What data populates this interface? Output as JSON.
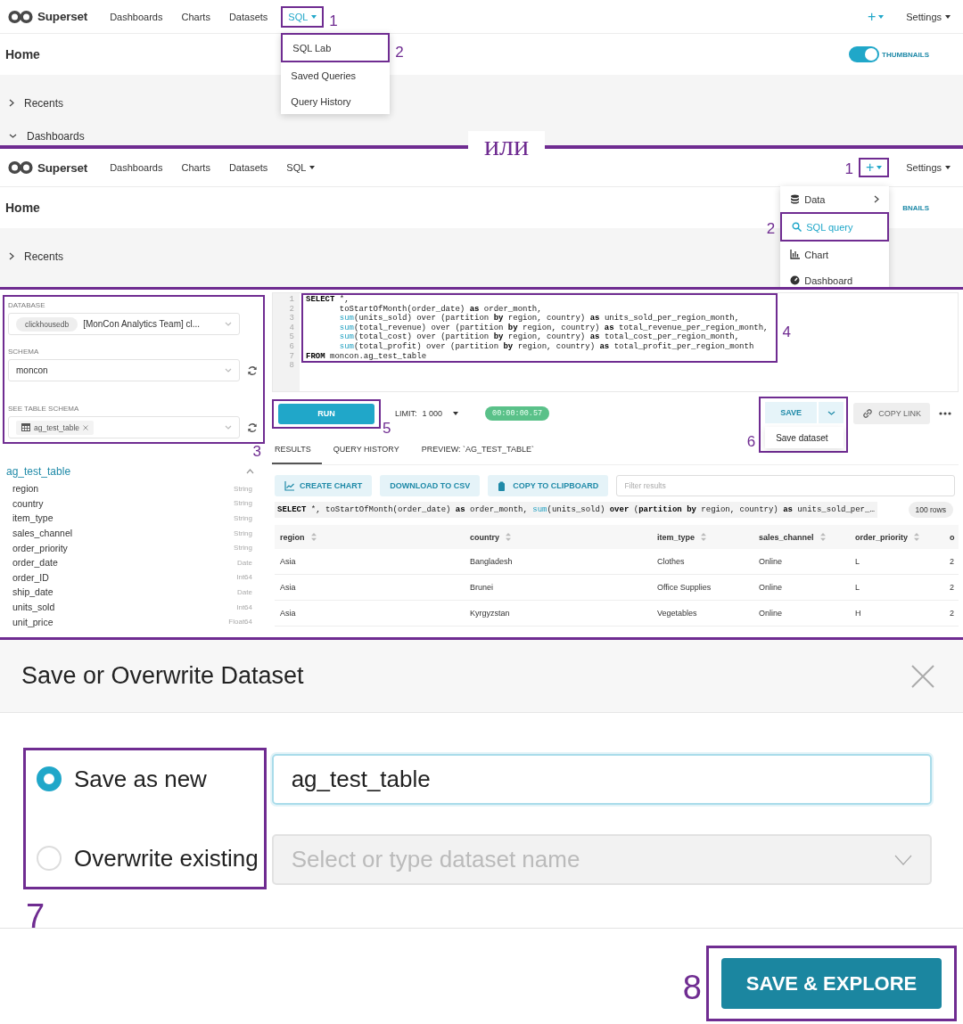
{
  "navigation_screens": [
    {
      "brand": "Superset",
      "nav_items": [
        {
          "label": "Dashboards",
          "selected": false
        },
        {
          "label": "Charts",
          "selected": false
        },
        {
          "label": "Datasets",
          "selected": false
        },
        {
          "label": "SQL",
          "selected": true,
          "has_menu": true,
          "annotation": {
            "number": "1"
          },
          "dropdown": {
            "items": [
              {
                "label": "SQL Lab",
                "selected": false,
                "annotation": {
                  "number": "2"
                }
              },
              {
                "label": "Saved Queries",
                "selected": false
              },
              {
                "label": "Query History",
                "selected": false
              }
            ]
          }
        }
      ],
      "add_button": {
        "label": "+"
      },
      "settings": "Settings",
      "page_title": "Home",
      "thumbnails": {
        "label": "THUMBNAILS",
        "on": true
      },
      "sections": [
        {
          "label": "Recents",
          "expanded": false
        },
        {
          "label": "Dashboards",
          "expanded": true
        }
      ]
    },
    {
      "brand": "Superset",
      "nav_items": [
        {
          "label": "Dashboards",
          "selected": false
        },
        {
          "label": "Charts",
          "selected": false
        },
        {
          "label": "Datasets",
          "selected": false
        },
        {
          "label": "SQL",
          "selected": false,
          "has_menu": true
        }
      ],
      "add_button": {
        "label": "+",
        "annotation": {
          "number": "1"
        },
        "dropdown": {
          "items": [
            {
              "label": "Data",
              "selected": false,
              "has_submenu": true
            },
            {
              "label": "SQL query",
              "selected": true,
              "annotation": {
                "number": "2"
              }
            },
            {
              "label": "Chart",
              "selected": false
            },
            {
              "label": "Dashboard",
              "selected": false
            }
          ]
        }
      },
      "settings": "Settings",
      "page_title": "Home",
      "thumbnails": {
        "label": "BNAILS"
      },
      "sections": [
        {
          "label": "Recents",
          "expanded": false
        }
      ]
    }
  ],
  "separator": "или",
  "sql_lab": {
    "sidebar": {
      "annotation": {
        "number": "3"
      },
      "database": {
        "label": "DATABASE",
        "tag": "clickhousedb",
        "value": "[MonCon Analytics Team] cl..."
      },
      "schema": {
        "label": "SCHEMA",
        "value": "moncon"
      },
      "table_schema": {
        "label": "SEE TABLE SCHEMA",
        "tag": "ag_test_table"
      },
      "table": {
        "name": "ag_test_table",
        "expanded": true,
        "columns": [
          {
            "name": "region",
            "type": "String"
          },
          {
            "name": "country",
            "type": "String"
          },
          {
            "name": "item_type",
            "type": "String"
          },
          {
            "name": "sales_channel",
            "type": "String"
          },
          {
            "name": "order_priority",
            "type": "String"
          },
          {
            "name": "order_date",
            "type": "Date"
          },
          {
            "name": "order_ID",
            "type": "Int64"
          },
          {
            "name": "ship_date",
            "type": "Date"
          },
          {
            "name": "units_sold",
            "type": "Int64"
          },
          {
            "name": "unit_price",
            "type": "Float64"
          }
        ]
      }
    },
    "editor": {
      "annotation": {
        "number": "4"
      },
      "line_numbers": [
        "1",
        "2",
        "3",
        "4",
        "5",
        "6",
        "7",
        "8"
      ],
      "lines": [
        {
          "indented": false,
          "tokens": [
            {
              "text": "SELECT",
              "kind": "keyword"
            },
            {
              "text": " *,",
              "kind": "plain"
            }
          ]
        },
        {
          "indented": true,
          "tokens": [
            {
              "text": "toStartOfMonth(order_date) ",
              "kind": "plain"
            },
            {
              "text": "as",
              "kind": "keyword"
            },
            {
              "text": " order_month,",
              "kind": "plain"
            }
          ]
        },
        {
          "indented": true,
          "tokens": [
            {
              "text": "sum",
              "kind": "function"
            },
            {
              "text": "(units_sold) over (partition ",
              "kind": "plain"
            },
            {
              "text": "by",
              "kind": "keyword"
            },
            {
              "text": " region, country) ",
              "kind": "plain"
            },
            {
              "text": "as",
              "kind": "keyword"
            },
            {
              "text": " units_sold_per_region_month,",
              "kind": "plain"
            }
          ]
        },
        {
          "indented": true,
          "tokens": [
            {
              "text": "sum",
              "kind": "function"
            },
            {
              "text": "(total_revenue) over (partition ",
              "kind": "plain"
            },
            {
              "text": "by",
              "kind": "keyword"
            },
            {
              "text": " region, country) ",
              "kind": "plain"
            },
            {
              "text": "as",
              "kind": "keyword"
            },
            {
              "text": " total_revenue_per_region_month,",
              "kind": "plain"
            }
          ]
        },
        {
          "indented": true,
          "tokens": [
            {
              "text": "sum",
              "kind": "function"
            },
            {
              "text": "(total_cost) over (partition ",
              "kind": "plain"
            },
            {
              "text": "by",
              "kind": "keyword"
            },
            {
              "text": " region, country) ",
              "kind": "plain"
            },
            {
              "text": "as",
              "kind": "keyword"
            },
            {
              "text": " total_cost_per_region_month,",
              "kind": "plain"
            }
          ]
        },
        {
          "indented": true,
          "tokens": [
            {
              "text": "sum",
              "kind": "function"
            },
            {
              "text": "(total_profit) over (partition ",
              "kind": "plain"
            },
            {
              "text": "by",
              "kind": "keyword"
            },
            {
              "text": " region, country) ",
              "kind": "plain"
            },
            {
              "text": "as",
              "kind": "keyword"
            },
            {
              "text": " total_profit_per_region_month",
              "kind": "plain"
            }
          ]
        },
        {
          "indented": false,
          "tokens": [
            {
              "text": "FROM",
              "kind": "keyword"
            },
            {
              "text": " moncon.ag_test_table",
              "kind": "plain"
            }
          ]
        }
      ]
    },
    "toolbar": {
      "run": {
        "label": "RUN",
        "annotation": {
          "number": "5"
        }
      },
      "limit_label": "LIMIT:",
      "limit_value": "1 000",
      "timer": "00:00:00.57",
      "save": {
        "label": "SAVE",
        "menu_item": "Save dataset",
        "annotation": {
          "number": "6"
        }
      },
      "copy_link": "COPY LINK"
    },
    "tabs": [
      {
        "label": "RESULTS",
        "selected": true
      },
      {
        "label": "QUERY HISTORY",
        "selected": false
      },
      {
        "label": "PREVIEW: `AG_TEST_TABLE`",
        "selected": false
      }
    ],
    "actions": [
      {
        "label": "CREATE CHART"
      },
      {
        "label": "DOWNLOAD TO CSV"
      },
      {
        "label": "COPY TO CLIPBOARD"
      }
    ],
    "filter": {
      "placeholder": "Filter results"
    },
    "query_text": [
      {
        "text": "SELECT",
        "kind": "keyword"
      },
      {
        "text": " *, toStartOfMonth(order_date) ",
        "kind": "plain"
      },
      {
        "text": "as",
        "kind": "keyword"
      },
      {
        "text": " order_month, ",
        "kind": "plain"
      },
      {
        "text": "sum",
        "kind": "function"
      },
      {
        "text": "(units_sold) ",
        "kind": "plain"
      },
      {
        "text": "over",
        "kind": "keyword"
      },
      {
        "text": " (",
        "kind": "plain"
      },
      {
        "text": "partition by",
        "kind": "keyword"
      },
      {
        "text": " region, country) ",
        "kind": "plain"
      },
      {
        "text": "as",
        "kind": "keyword"
      },
      {
        "text": " units_sold_per_…",
        "kind": "plain"
      }
    ],
    "row_count": "100 rows",
    "table": {
      "columns": [
        "region",
        "country",
        "item_type",
        "sales_channel",
        "order_priority",
        "o"
      ],
      "rows": [
        [
          "Asia",
          "Bangladesh",
          "Clothes",
          "Online",
          "L",
          "2"
        ],
        [
          "Asia",
          "Brunei",
          "Office Supplies",
          "Online",
          "L",
          "2"
        ],
        [
          "Asia",
          "Kyrgyzstan",
          "Vegetables",
          "Online",
          "H",
          "2"
        ]
      ]
    }
  },
  "save_dialog": {
    "title": "Save or Overwrite Dataset",
    "options_annotation": {
      "number": "7"
    },
    "options": [
      {
        "label": "Save as new",
        "selected": true
      },
      {
        "label": "Overwrite existing",
        "selected": false
      }
    ],
    "name_field": {
      "value": "ag_test_table"
    },
    "existing_field": {
      "placeholder": "Select or type dataset name",
      "disabled": true
    },
    "submit": {
      "label": "SAVE & EXPLORE",
      "annotation": {
        "number": "8"
      }
    }
  }
}
